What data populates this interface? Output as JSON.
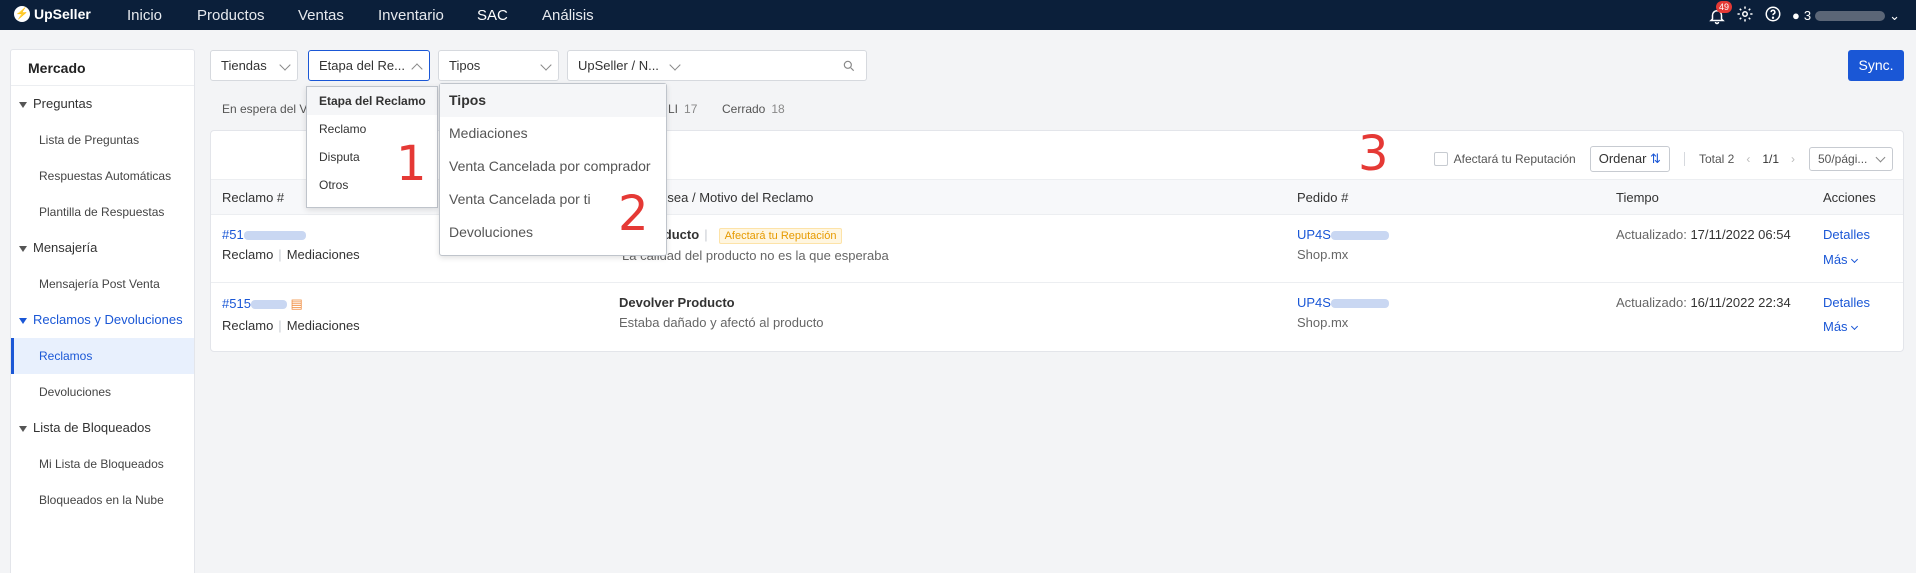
{
  "app": {
    "brand": "UpSeller"
  },
  "nav": {
    "items": [
      "Inicio",
      "Productos",
      "Ventas",
      "Inventario",
      "SAC",
      "Análisis"
    ],
    "active": "SAC"
  },
  "topright": {
    "notifications": "49",
    "user": "3"
  },
  "sidebar": {
    "title": "Mercado",
    "groups": [
      {
        "label": "Preguntas",
        "items": [
          "Lista de Preguntas",
          "Respuestas Automáticas",
          "Plantilla de Respuestas"
        ]
      },
      {
        "label": "Mensajería",
        "items": [
          "Mensajería Post Venta"
        ]
      },
      {
        "label": "Reclamos y Devoluciones",
        "items": [
          "Reclamos",
          "Devoluciones"
        ]
      },
      {
        "label": "Lista de Bloqueados",
        "items": [
          "Mi Lista de Bloqueados",
          "Bloqueados en la Nube"
        ]
      }
    ]
  },
  "filters": {
    "tiendas": "Tiendas",
    "etapa": "Etapa del Re...",
    "tipos": "Tipos",
    "upseller": "UpSeller / N...",
    "search_placeholder": ""
  },
  "sync_label": "Sync.",
  "status_tabs": {
    "espera": "En espera del V",
    "li_label": "LI",
    "li_count": "17",
    "cerrado_label": "Cerrado",
    "cerrado_count": "18"
  },
  "toolbar": {
    "reputation_filter": "Afectará tu Reputación",
    "ordenar": "Ordenar",
    "total": "Total 2",
    "page": "1/1",
    "per_page": "50/pági..."
  },
  "table": {
    "headers": [
      "Reclamo #",
      "rador desea / Motivo del Reclamo",
      "Pedido #",
      "Tiempo",
      "Acciones"
    ],
    "rows": [
      {
        "id_prefix": "#51",
        "type": "Reclamo",
        "stage": "Mediaciones",
        "action": "Devolver Producto",
        "action_visible": "ver Producto",
        "tag": "Afectará tu Reputación",
        "reason": "La calidad del producto no es la que esperaba",
        "order_prefix": "UP4S",
        "shop": "Shop.mx",
        "time_label": "Actualizado:",
        "time_value": "17/11/2022 06:54",
        "details": "Detalles",
        "more": "Más"
      },
      {
        "id_prefix": "#515",
        "type": "Reclamo",
        "stage": "Mediaciones",
        "action": "Devolver Producto",
        "reason": "Estaba dañado y afectó al producto",
        "order_prefix": "UP4S",
        "shop": "Shop.mx",
        "time_label": "Actualizado:",
        "time_value": "16/11/2022 22:34",
        "details": "Detalles",
        "more": "Más"
      }
    ]
  },
  "dropdown_etapa": {
    "header": "Etapa del Reclamo",
    "options": [
      "Reclamo",
      "Disputa",
      "Otros"
    ]
  },
  "dropdown_tipos": {
    "header": "Tipos",
    "options": [
      "Mediaciones",
      "Venta Cancelada por comprador",
      "Venta Cancelada por ti",
      "Devoluciones"
    ]
  },
  "annotations": [
    "1",
    "2",
    "3"
  ],
  "colors": {
    "primary": "#1a57d6",
    "topbar": "#0b1f3a",
    "annotation": "#e53935",
    "warning": "#e69a00"
  }
}
